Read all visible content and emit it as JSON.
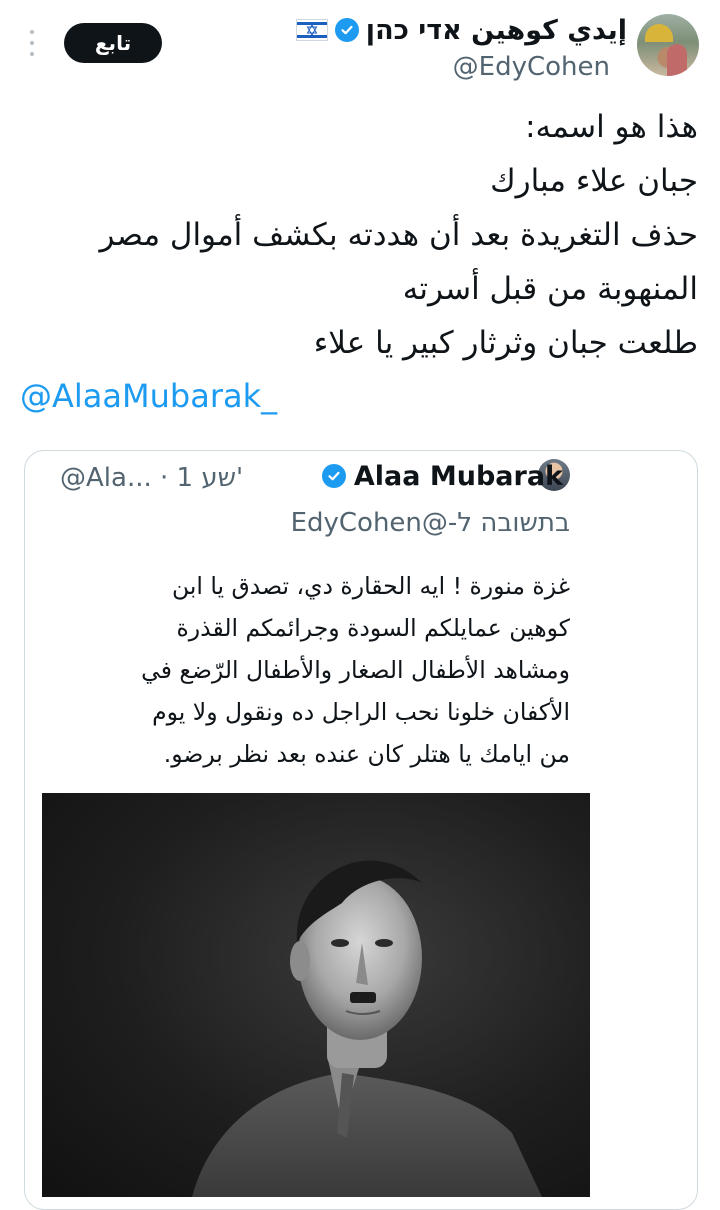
{
  "tweet": {
    "display_name": "إيدي كوهين אדי כהן",
    "handle": "@EdyCohen",
    "follow_label": "تابع",
    "text_lines": [
      "هذا هو اسمه:",
      "جبان علاء مبارك",
      "حذف التغريدة بعد أن هددته بكشف أموال مصر",
      "المنهوبة من قبل أسرته",
      "طلعت جبان وثرثار كبير يا علاء"
    ],
    "mention": "@AlaaMubarak_"
  },
  "quoted": {
    "name": "Alaa Mubarak",
    "handle_time": "@Ala... · 1 שע'",
    "reply_to": "בתשובה ל-@EdyCohen",
    "text_lines": [
      "غزة منورة ! ايه الحقارة دي، تصدق يا ابن",
      "كوهين عمايلكم السودة وجرائمكم القذرة",
      "ومشاهد الأطفال الصغار والأطفال الرّضع في",
      "الأكفان خلونا نحب الراجل ده ونقول ولا يوم",
      "من ايامك يا هتلر كان عنده بعد نظر برضو."
    ]
  },
  "icons": {
    "verified": "verified-badge-icon",
    "flag": "israel-flag-icon",
    "more": "more-vertical-icon"
  },
  "colors": {
    "link_blue": "#1d9bf0",
    "secondary_text": "#536471",
    "follow_button_bg": "#0f1419",
    "border": "#cfd9de"
  }
}
